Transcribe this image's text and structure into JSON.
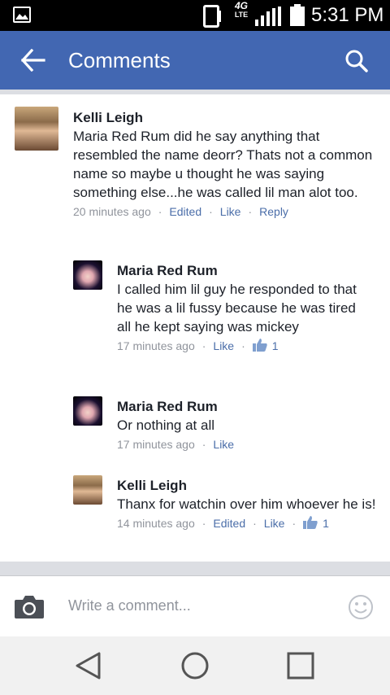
{
  "status_bar": {
    "network": "4G",
    "network_sub": "LTE",
    "time": "5:31 PM"
  },
  "header": {
    "title": "Comments"
  },
  "comments": [
    {
      "name": "Kelli Leigh",
      "text": "Maria Red Rum did he say anything that resembled the name deorr? Thats not a common name so maybe u thought he was saying something else...he was called lil man alot too.",
      "time": "20 minutes ago",
      "edited": "Edited",
      "like": "Like",
      "reply": "Reply"
    },
    {
      "name": "Maria Red Rum",
      "text": "I called him lil guy he responded to that he was a lil fussy because he was tired all he kept saying was mickey",
      "time": "17 minutes ago",
      "like": "Like",
      "likes_count": "1"
    },
    {
      "name": "Maria Red Rum",
      "text": "Or nothing at all",
      "time": "17 minutes ago",
      "like": "Like"
    },
    {
      "name": "Kelli Leigh",
      "text": "Thanx for watchin over him whoever he is!",
      "time": "14 minutes ago",
      "edited": "Edited",
      "like": "Like",
      "likes_count": "1"
    }
  ],
  "composer": {
    "placeholder": "Write a comment..."
  },
  "colors": {
    "header": "#4267b2",
    "link": "#4b6ea9",
    "meta": "#90949c"
  },
  "icons": [
    "gallery-icon",
    "phone-icon",
    "signal-icon",
    "battery-icon",
    "back-arrow-icon",
    "search-icon",
    "thumbs-up-icon",
    "camera-icon",
    "smiley-icon",
    "nav-back-icon",
    "nav-home-icon",
    "nav-recents-icon"
  ]
}
